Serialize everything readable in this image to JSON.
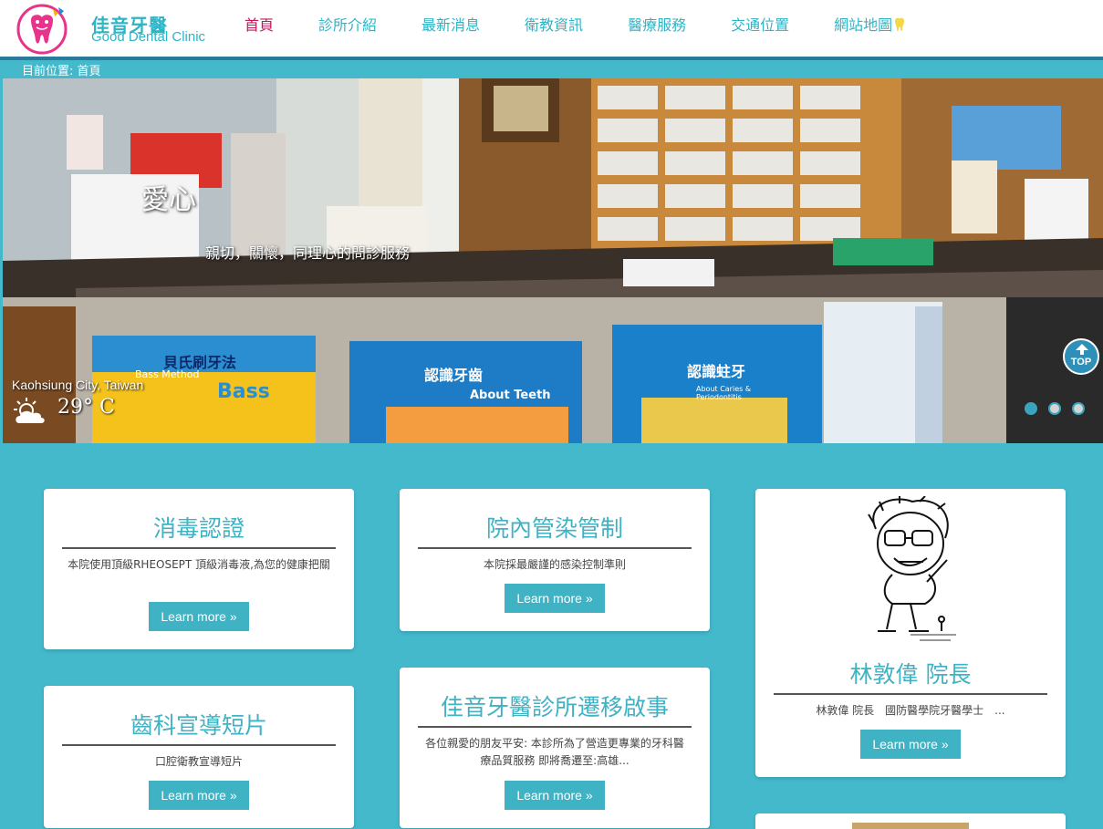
{
  "header": {
    "logo_cn": "佳音牙醫",
    "logo_en": "Good Dental Clinic",
    "nav": [
      {
        "label": "首頁",
        "active": true
      },
      {
        "label": "診所介紹",
        "active": false
      },
      {
        "label": "最新消息",
        "active": false
      },
      {
        "label": "衛教資訊",
        "active": false
      },
      {
        "label": "醫療服務",
        "active": false
      },
      {
        "label": "交通位置",
        "active": false
      },
      {
        "label": "網站地圖",
        "active": false
      }
    ]
  },
  "breadcrumb": "目前位置: 首頁",
  "hero": {
    "caption_title": "愛心",
    "caption_text": "親切，關懷，同理心的問診服務",
    "weather_city": "Kaohsiung City, Taiwan",
    "weather_temp": "29° C",
    "weather_icon": "partly-cloudy-icon",
    "slides": 3,
    "active_slide": 1,
    "poster_1_title": "貝氏刷牙法",
    "poster_1_sub": "Bass Method",
    "poster_1_big": "Bass",
    "poster_2_title": "認識牙齒",
    "poster_2_sub": "About Teeth",
    "poster_3_title": "認識蛀牙",
    "poster_3_sub": "About Caries & Periodontitis"
  },
  "top_button": "TOP",
  "cards": [
    {
      "title": "消毒認證",
      "text": "本院使用頂級RHEOSEPT 頂級消毒液,為您的健康把關",
      "button": "Learn more »"
    },
    {
      "title": "院內管染管制",
      "text": "本院採最嚴謹的感染控制準則",
      "button": "Learn more »"
    },
    {
      "title": "林敦偉 院長",
      "text": "林敦偉 院長　國防醫學院牙醫學士　...",
      "button": "Learn more »"
    },
    {
      "title": "齒科宣導短片",
      "text": "口腔衛教宣導短片",
      "button": "Learn more »"
    },
    {
      "title": "佳音牙醫診所遷移啟事",
      "text": "各位親愛的朋友平安: 本診所為了營造更專業的牙科醫療品質服務 即將喬遷至:高雄...",
      "button": "Learn more »"
    }
  ],
  "colors": {
    "brand": "#2fb4c6",
    "active_nav": "#c2195d",
    "background": "#44b9cc",
    "button": "#3fb2c4"
  }
}
